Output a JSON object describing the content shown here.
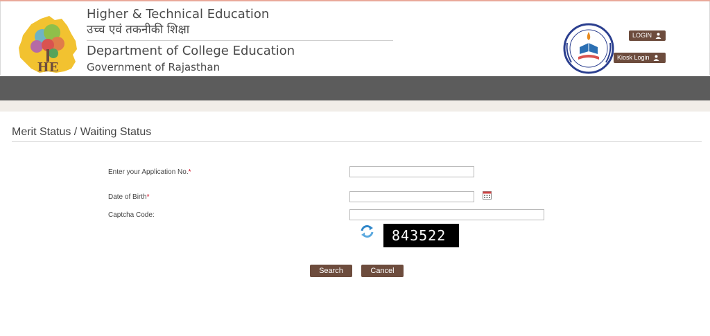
{
  "header": {
    "title_en": "Higher & Technical Education",
    "title_hi": "उच्च एवं तकनीकी शिक्षा",
    "department": "Department of College Education",
    "government": "Government of Rajasthan",
    "logo_letters": "HE",
    "login_label": "LOGIN",
    "kiosk_label": "Kiosk Login"
  },
  "page": {
    "title": "Merit Status / Waiting Status"
  },
  "form": {
    "application_label": "Enter your Application No.",
    "dob_label": "Date of Birth",
    "captcha_label": "Captcha Code:",
    "required_mark": "*",
    "application_value": "",
    "dob_value": "",
    "captcha_value": "",
    "captcha_text": "843522",
    "search_label": "Search",
    "cancel_label": "Cancel"
  },
  "icons": {
    "calendar": "calendar-icon",
    "refresh": "refresh-icon",
    "user": "user-icon"
  },
  "colors": {
    "button_brown": "#6d4c3d",
    "nav_gray": "#5c5c5c",
    "required_red": "#d0021b",
    "captcha_bg": "#000000"
  }
}
